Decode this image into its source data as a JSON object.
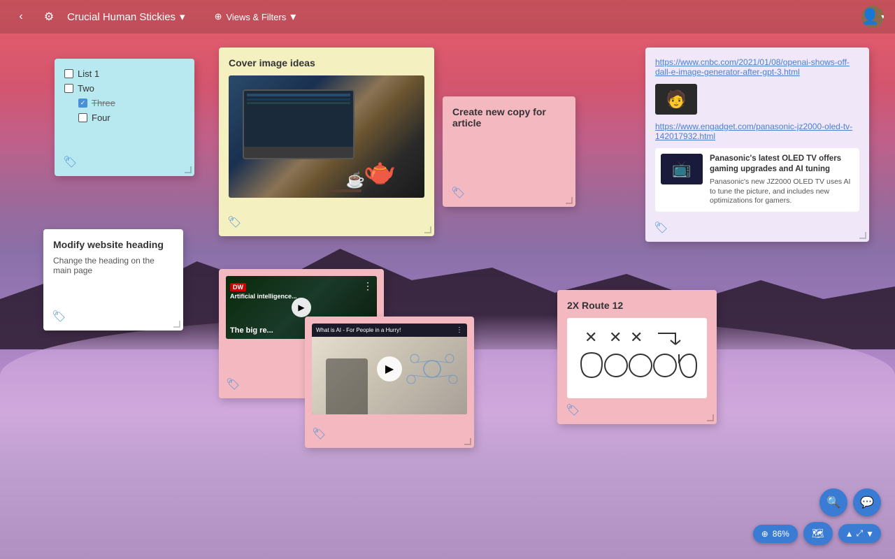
{
  "app": {
    "title": "Crucial Human Stickies",
    "views_label": "Views & Filters"
  },
  "topbar": {
    "back_icon": "‹",
    "settings_icon": "⚙",
    "dropdown_icon": "▾",
    "avatar_icon": "👤",
    "layers_icon": "⊕"
  },
  "stickies": {
    "checklist": {
      "title": "",
      "items": [
        {
          "label": "List 1",
          "checked": false,
          "indent": 0
        },
        {
          "label": "Two",
          "checked": false,
          "indent": 0
        },
        {
          "label": "Three",
          "checked": true,
          "indent": 1
        },
        {
          "label": "Four",
          "checked": false,
          "indent": 1
        }
      ]
    },
    "cover": {
      "title": "Cover image ideas"
    },
    "create_copy": {
      "title": "Create new copy for article"
    },
    "links": {
      "link1": "https://www.cnbc.com/2021/01/08/openai-shows-off-dall-e-image-generator-after-gpt-3.html",
      "link2": "https://www.engadget.com/panasonic-jz2000-oled-tv-142017932.html",
      "card_title": "Panasonic's latest OLED TV offers gaming upgrades and AI tuning",
      "card_desc": "Panasonic's new JZ2000 OLED TV uses AI to tune the picture, and includes new optimizations for gamers."
    },
    "modify": {
      "title": "Modify website heading",
      "text": "Change the heading on the main page"
    },
    "video1": {
      "badge": "DW",
      "title": "Artificial intelligence...",
      "subtitle": "The big re..."
    },
    "video2": {
      "title": "What is AI - For People in a Hurry!"
    },
    "route": {
      "title": "2X Route 12"
    }
  },
  "controls": {
    "zoom_level": "86%",
    "zoom_icon": "⊕",
    "chat_icon": "💬",
    "search_icon": "🔍",
    "map_icon": "🗺",
    "expand_icon": "⤢",
    "arrows": "⬆⬇"
  }
}
